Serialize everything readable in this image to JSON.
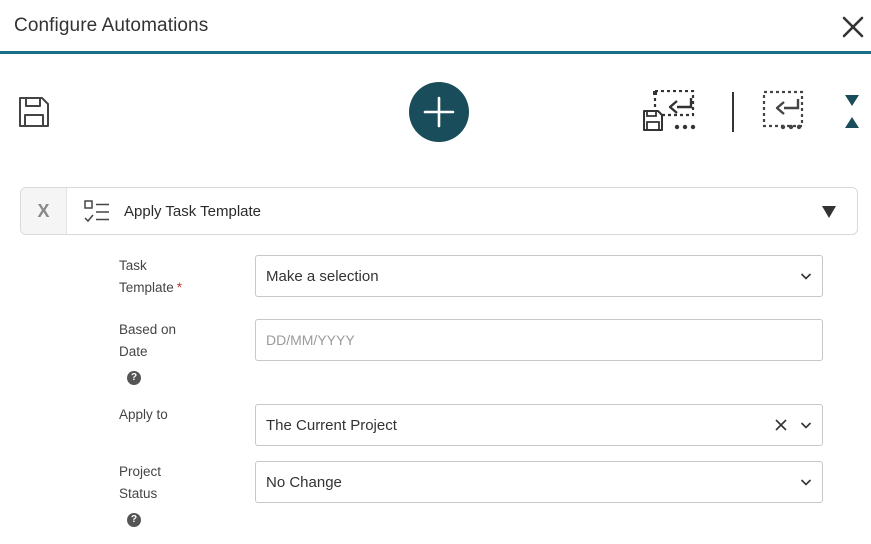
{
  "dialog": {
    "title": "Configure Automations",
    "accent_color": "#1a6f88",
    "add_button_color": "#1a4d5c"
  },
  "toolbar": {
    "save_icon": "floppy-disk-icon",
    "add_icon": "plus-icon",
    "save_return_icon": "save-and-return-icon",
    "return_icon": "return-icon",
    "collapse_icon": "expand-collapse-icon"
  },
  "action": {
    "remove_label": "X",
    "icon": "checklist-icon",
    "title": "Apply Task Template",
    "toggle_icon": "triangle-down-icon"
  },
  "fields": {
    "task_template": {
      "label_line1": "Task",
      "label_line2": "Template",
      "required_mark": "*",
      "value": "Make a selection"
    },
    "based_on_date": {
      "label_line1": "Based on",
      "label_line2": "Date",
      "help": "?",
      "placeholder": "DD/MM/YYYY"
    },
    "apply_to": {
      "label": "Apply to",
      "value": "The Current Project"
    },
    "project_status": {
      "label_line1": "Project",
      "label_line2": "Status",
      "help": "?",
      "value": "No Change"
    }
  }
}
